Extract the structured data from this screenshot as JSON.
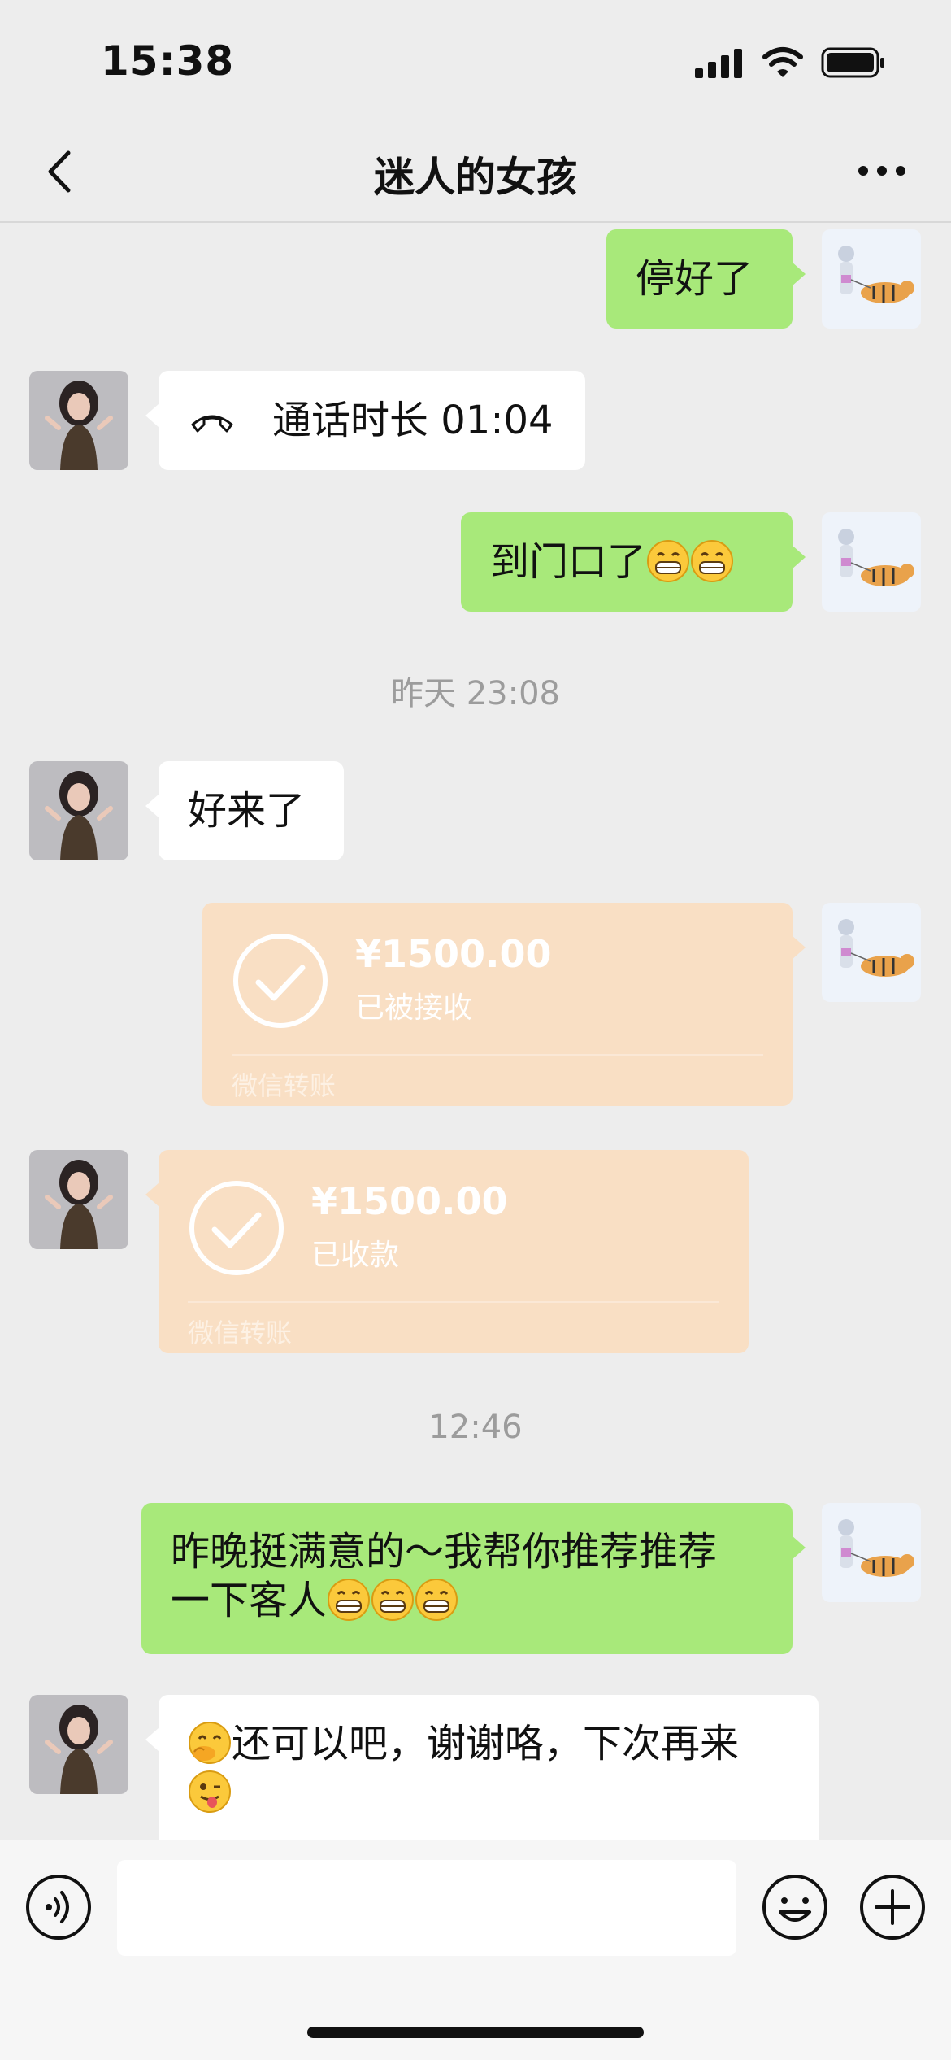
{
  "status_bar": {
    "time": "15:38"
  },
  "header": {
    "title": "迷人的女孩"
  },
  "messages": {
    "m1": {
      "text": "停好了"
    },
    "m2": {
      "text": "通话时长 01:04",
      "icon": "phone-hangup-icon"
    },
    "m3": {
      "text": "到门口了",
      "emoji": [
        "grinning-face",
        "grinning-face"
      ]
    },
    "ts1": "昨天 23:08",
    "m4": {
      "text": "好来了"
    },
    "t1": {
      "amount": "¥1500.00",
      "status": "已被接收",
      "brand": "微信转账"
    },
    "t2": {
      "amount": "¥1500.00",
      "status": "已收款",
      "brand": "微信转账"
    },
    "ts2": "12:46",
    "m5": {
      "line1": "昨晚挺满意的～我帮你推荐推荐",
      "line2": "一下客人",
      "emoji": [
        "grinning-face",
        "grinning-face",
        "grinning-face"
      ]
    },
    "m6": {
      "text": "还可以吧，谢谢咯，下次再来",
      "emoji_start": "face-with-hand-over-mouth",
      "emoji_end": "winking-face-with-tongue"
    }
  },
  "input": {
    "value": "",
    "placeholder": ""
  },
  "colors": {
    "sent_bubble": "#a8e97a",
    "received_bubble": "#ffffff",
    "transfer": "#f9dfc4",
    "background": "#ededed"
  }
}
